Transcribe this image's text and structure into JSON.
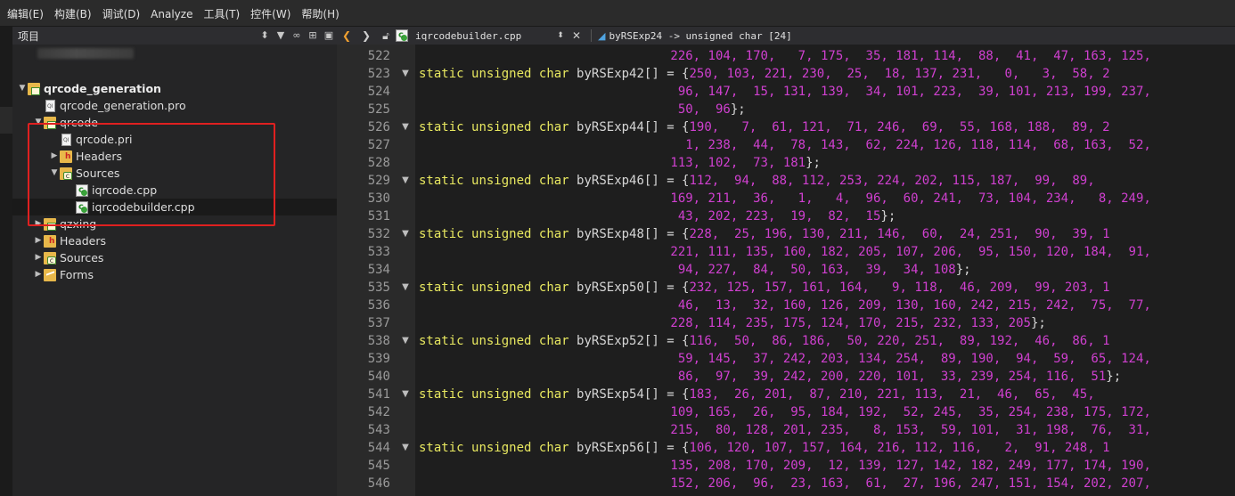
{
  "menu": [
    "编辑(E)",
    "构建(B)",
    "调试(D)",
    "Analyze",
    "工具(T)",
    "控件(W)",
    "帮助(H)"
  ],
  "projects_panel": {
    "title": "项目",
    "icons": [
      "updown-icon",
      "filter-icon",
      "link-icon",
      "split-icon",
      "close-panel-icon"
    ]
  },
  "tree": [
    {
      "label": "qrcode_generation",
      "depth": 0,
      "expander": "open",
      "icon": "project-folder-icon",
      "bold": true
    },
    {
      "label": "qrcode_generation.pro",
      "depth": 1,
      "expander": "none",
      "icon": "pro-file-icon",
      "bold": false
    },
    {
      "label": "qrcode",
      "depth": 1,
      "expander": "open",
      "icon": "project-folder-icon",
      "bold": false
    },
    {
      "label": "qrcode.pri",
      "depth": 2,
      "expander": "none",
      "icon": "pri-file-icon",
      "bold": false
    },
    {
      "label": "Headers",
      "depth": 2,
      "expander": "closed",
      "icon": "headers-folder-icon",
      "bold": false
    },
    {
      "label": "Sources",
      "depth": 2,
      "expander": "open",
      "icon": "sources-folder-icon",
      "bold": false
    },
    {
      "label": "iqrcode.cpp",
      "depth": 3,
      "expander": "none",
      "icon": "cpp-file-icon",
      "bold": false
    },
    {
      "label": "iqrcodebuilder.cpp",
      "depth": 3,
      "expander": "none",
      "icon": "cpp-file-icon",
      "bold": false,
      "selected": true
    },
    {
      "label": "qzxing",
      "depth": 1,
      "expander": "closed",
      "icon": "project-folder-icon",
      "bold": false
    },
    {
      "label": "Headers",
      "depth": 1,
      "expander": "closed",
      "icon": "headers-folder-icon",
      "bold": false
    },
    {
      "label": "Sources",
      "depth": 1,
      "expander": "closed",
      "icon": "sources-folder-icon",
      "bold": false
    },
    {
      "label": "Forms",
      "depth": 1,
      "expander": "closed",
      "icon": "forms-folder-icon",
      "bold": false
    }
  ],
  "editor_toolbar": {
    "file": "iqrcodebuilder.cpp",
    "function": "byRSExp24 -> unsigned char [24]"
  },
  "colors": {
    "keyword": "#e8e860",
    "number": "#d040d0",
    "line_number": "#9a9a9a",
    "highlight_box": "#e02020"
  },
  "code_lines": [
    {
      "n": "522",
      "fold": false,
      "decl": "",
      "nums": "226, 104, 170,   7, 175,  35, 181, 114,  88,  41,  47, 163, 125,",
      "end": ""
    },
    {
      "n": "523",
      "fold": true,
      "decl": "byRSExp42[] = {",
      "nums": "250, 103, 221, 230,  25,  18, 137, 231,   0,   3,  58, 2",
      "end": ""
    },
    {
      "n": "524",
      "fold": false,
      "decl": "",
      "nums": " 96, 147,  15, 131, 139,  34, 101, 223,  39, 101, 213, 199, 237,",
      "end": ""
    },
    {
      "n": "525",
      "fold": false,
      "decl": "",
      "nums": " 50,  96",
      "end": "};"
    },
    {
      "n": "526",
      "fold": true,
      "decl": "byRSExp44[] = {",
      "nums": "190,   7,  61, 121,  71, 246,  69,  55, 168, 188,  89, 2",
      "end": ""
    },
    {
      "n": "527",
      "fold": false,
      "decl": "",
      "nums": "  1, 238,  44,  78, 143,  62, 224, 126, 118, 114,  68, 163,  52,",
      "end": ""
    },
    {
      "n": "528",
      "fold": false,
      "decl": "",
      "nums": "113, 102,  73, 181",
      "end": "};"
    },
    {
      "n": "529",
      "fold": true,
      "decl": "byRSExp46[] = {",
      "nums": "112,  94,  88, 112, 253, 224, 202, 115, 187,  99,  89,",
      "end": ""
    },
    {
      "n": "530",
      "fold": false,
      "decl": "",
      "nums": "169, 211,  36,   1,   4,  96,  60, 241,  73, 104, 234,   8, 249,",
      "end": ""
    },
    {
      "n": "531",
      "fold": false,
      "decl": "",
      "nums": " 43, 202, 223,  19,  82,  15",
      "end": "};"
    },
    {
      "n": "532",
      "fold": true,
      "decl": "byRSExp48[] = {",
      "nums": "228,  25, 196, 130, 211, 146,  60,  24, 251,  90,  39, 1",
      "end": ""
    },
    {
      "n": "533",
      "fold": false,
      "decl": "",
      "nums": "221, 111, 135, 160, 182, 205, 107, 206,  95, 150, 120, 184,  91,",
      "end": ""
    },
    {
      "n": "534",
      "fold": false,
      "decl": "",
      "nums": " 94, 227,  84,  50, 163,  39,  34, 108",
      "end": "};"
    },
    {
      "n": "535",
      "fold": true,
      "decl": "byRSExp50[] = {",
      "nums": "232, 125, 157, 161, 164,   9, 118,  46, 209,  99, 203, 1",
      "end": ""
    },
    {
      "n": "536",
      "fold": false,
      "decl": "",
      "nums": " 46,  13,  32, 160, 126, 209, 130, 160, 242, 215, 242,  75,  77,",
      "end": ""
    },
    {
      "n": "537",
      "fold": false,
      "decl": "",
      "nums": "228, 114, 235, 175, 124, 170, 215, 232, 133, 205",
      "end": "};"
    },
    {
      "n": "538",
      "fold": true,
      "decl": "byRSExp52[] = {",
      "nums": "116,  50,  86, 186,  50, 220, 251,  89, 192,  46,  86, 1",
      "end": ""
    },
    {
      "n": "539",
      "fold": false,
      "decl": "",
      "nums": " 59, 145,  37, 242, 203, 134, 254,  89, 190,  94,  59,  65, 124,",
      "end": ""
    },
    {
      "n": "540",
      "fold": false,
      "decl": "",
      "nums": " 86,  97,  39, 242, 200, 220, 101,  33, 239, 254, 116,  51",
      "end": "};"
    },
    {
      "n": "541",
      "fold": true,
      "decl": "byRSExp54[] = {",
      "nums": "183,  26, 201,  87, 210, 221, 113,  21,  46,  65,  45,",
      "end": ""
    },
    {
      "n": "542",
      "fold": false,
      "decl": "",
      "nums": "109, 165,  26,  95, 184, 192,  52, 245,  35, 254, 238, 175, 172,",
      "end": ""
    },
    {
      "n": "543",
      "fold": false,
      "decl": "",
      "nums": "215,  80, 128, 201, 235,   8, 153,  59, 101,  31, 198,  76,  31,",
      "end": ""
    },
    {
      "n": "544",
      "fold": true,
      "decl": "byRSExp56[] = {",
      "nums": "106, 120, 107, 157, 164, 216, 112, 116,   2,  91, 248, 1",
      "end": ""
    },
    {
      "n": "545",
      "fold": false,
      "decl": "",
      "nums": "135, 208, 170, 209,  12, 139, 127, 142, 182, 249, 177, 174, 190,",
      "end": ""
    },
    {
      "n": "546",
      "fold": false,
      "decl": "",
      "nums": "152, 206,  96,  23, 163,  61,  27, 196, 247, 151, 154, 202, 207,",
      "end": ""
    }
  ],
  "keywords": [
    "static",
    "unsigned",
    "char"
  ]
}
